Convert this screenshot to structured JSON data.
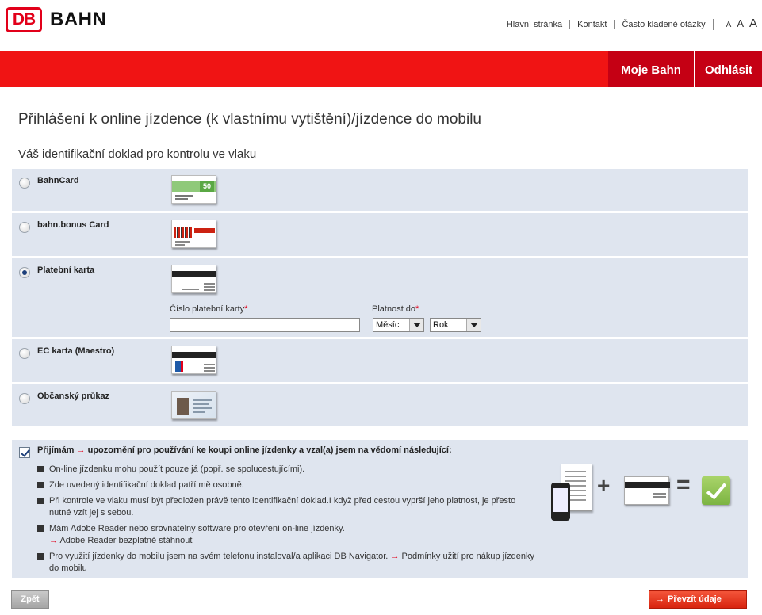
{
  "header": {
    "logo_mark": "DB",
    "logo_text": "BAHN",
    "nav": [
      "Hlavní stránka",
      "Kontakt",
      "Často kladené otázky"
    ],
    "font_sizes": [
      "A",
      "A",
      "A"
    ]
  },
  "redbar": {
    "tabs": [
      "Moje Bahn",
      "Odhlásit"
    ],
    "color": "#f01414",
    "tab_color": "#c50014"
  },
  "page": {
    "title": "Přihlášení k online jízdence (k vlastnímu vytištění)/jízdence do mobilu",
    "subtitle": "Váš identifikační doklad pro kontrolu ve vlaku"
  },
  "id_options": [
    {
      "label": "BahnCard",
      "selected": false,
      "icon": "bahncard-icon"
    },
    {
      "label": "bahn.bonus Card",
      "selected": false,
      "icon": "bonus-card-icon"
    },
    {
      "label": "Platební karta",
      "selected": true,
      "icon": "payment-card-icon"
    },
    {
      "label": "EC karta (Maestro)",
      "selected": false,
      "icon": "ec-card-icon"
    },
    {
      "label": "Občanský průkaz",
      "selected": false,
      "icon": "id-card-icon"
    }
  ],
  "card_bahn_number": "50",
  "payment_form": {
    "card_number_label": "Číslo platební karty",
    "card_number_value": "",
    "validity_label": "Platnost do",
    "required_mark": "*",
    "month_value": "Měsíc",
    "year_value": "Rok"
  },
  "terms": {
    "checked": true,
    "prefix": "Přijímám",
    "arrow": "→",
    "heading": "upozornění pro používání ke koupi online jízdenky a vzal(a) jsem na vědomí následující:",
    "items": [
      "On-line jízdenku mohu použít pouze já (popř. se spolucestujícími).",
      "Zde uvedený identifikační doklad patří mě osobně.",
      "Při kontrole ve vlaku musí být předložen právě tento identifikační doklad.I když před cestou vyprší jeho platnost, je přesto nutné vzít jej s sebou.",
      "Mám Adobe Reader nebo srovnatelný software pro otevření on-line jízdenky.",
      "Pro využití jízdenky do mobilu jsem na svém telefonu instaloval/a aplikaci DB Navigator."
    ],
    "adobe_link": "Adobe Reader bezplatně stáhnout",
    "mobile_link": "Podmínky užití pro nákup jízdenky do mobilu",
    "illustration_plus": "+",
    "illustration_eq": "="
  },
  "buttons": {
    "back": "Zpět",
    "submit": "Převzít údaje"
  }
}
